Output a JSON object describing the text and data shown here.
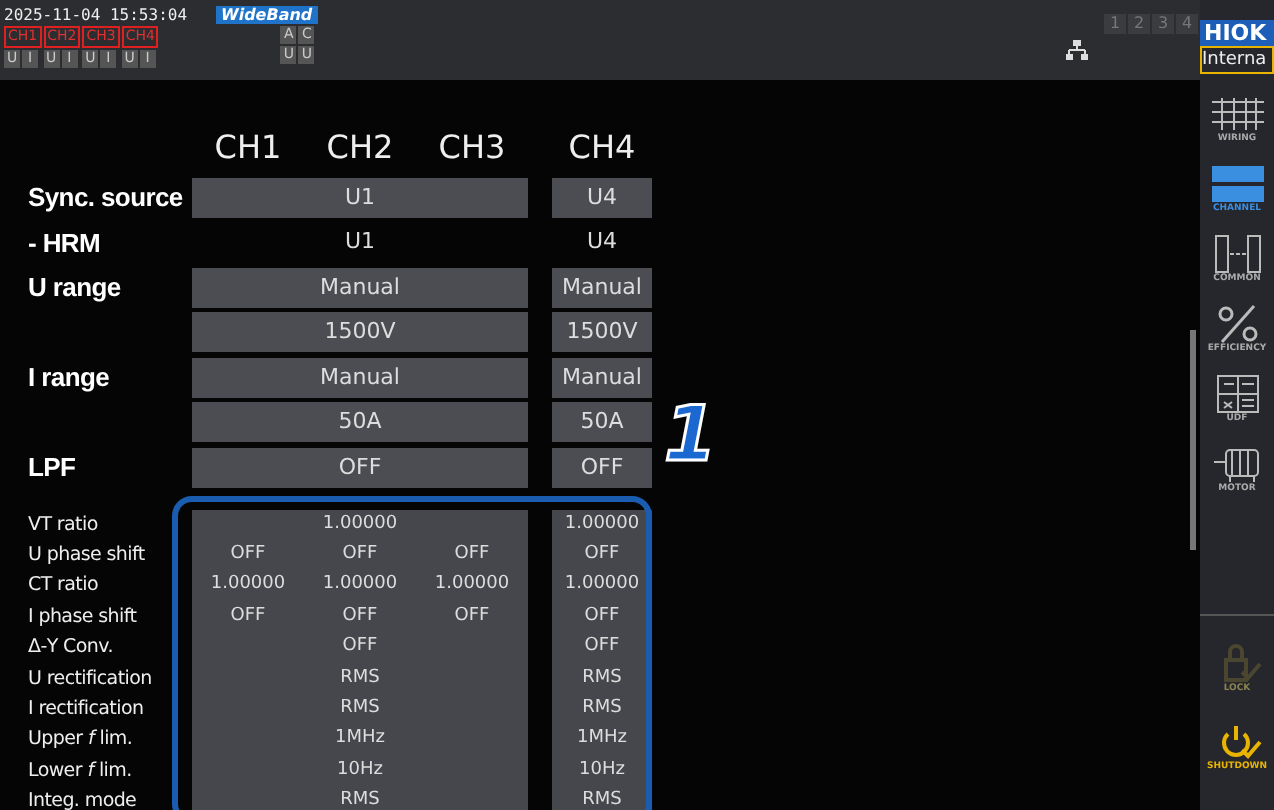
{
  "status_bar": {
    "datetime": "2025-11-04 15:53:04",
    "mode_badge": "WideBand",
    "channels": [
      {
        "label": "CH1",
        "inputs": [
          "U",
          "I"
        ]
      },
      {
        "label": "CH2",
        "inputs": [
          "U",
          "I"
        ]
      },
      {
        "label": "CH3",
        "inputs": [
          "U",
          "I"
        ]
      },
      {
        "label": "CH4",
        "inputs": [
          "U",
          "I"
        ]
      }
    ],
    "aux_top": [
      "A",
      "C"
    ],
    "aux_bottom": [
      "U",
      "U"
    ],
    "slots": [
      "1",
      "2",
      "3",
      "4"
    ],
    "logo": "HIOK",
    "sync_field": "Interna"
  },
  "table": {
    "columns": [
      "CH1",
      "CH2",
      "CH3",
      "CH4"
    ],
    "rows": [
      {
        "label": "Sync. source",
        "kind": "select",
        "cells": [
          "U1"
        ],
        "ch4": "U4"
      },
      {
        "label": "- HRM",
        "kind": "plain",
        "cells": [
          "U1"
        ],
        "ch4": "U4"
      },
      {
        "label": "U range",
        "kind": "select",
        "cells": [
          "Manual"
        ],
        "ch4": "Manual"
      },
      {
        "label": "",
        "kind": "select",
        "cells": [
          "1500V"
        ],
        "ch4": "1500V"
      },
      {
        "label": "I range",
        "kind": "select",
        "cells": [
          "Manual"
        ],
        "ch4": "Manual"
      },
      {
        "label": "",
        "kind": "select",
        "cells": [
          "50A"
        ],
        "ch4": "50A"
      },
      {
        "label": "LPF",
        "kind": "select",
        "cells": [
          "OFF"
        ],
        "ch4": "OFF"
      }
    ],
    "detail_rows": [
      {
        "label": "VT ratio",
        "cells": [
          "1.00000"
        ],
        "ch4": "1.00000"
      },
      {
        "label": "U phase shift",
        "cells": [
          "OFF",
          "OFF",
          "OFF"
        ],
        "ch4": "OFF"
      },
      {
        "label": "CT ratio",
        "cells": [
          "1.00000",
          "1.00000",
          "1.00000"
        ],
        "ch4": "1.00000"
      },
      {
        "label": "I phase shift",
        "cells": [
          "OFF",
          "OFF",
          "OFF"
        ],
        "ch4": "OFF"
      },
      {
        "label": "Δ-Y Conv.",
        "cells": [
          "OFF"
        ],
        "ch4": "OFF"
      },
      {
        "label": "U rectification",
        "cells": [
          "RMS"
        ],
        "ch4": "RMS"
      },
      {
        "label": "I rectification",
        "cells": [
          "RMS"
        ],
        "ch4": "RMS"
      },
      {
        "label": "Upper *f* lim.",
        "cells": [
          "1MHz"
        ],
        "ch4": "1MHz"
      },
      {
        "label": "Lower *f* lim.",
        "cells": [
          "10Hz"
        ],
        "ch4": "10Hz"
      },
      {
        "label": "Integ. mode",
        "cells": [
          "RMS"
        ],
        "ch4": "RMS"
      }
    ]
  },
  "callout": {
    "number": "1"
  },
  "sidebar": {
    "items": [
      {
        "label": "WIRING",
        "selected": false
      },
      {
        "label": "CHANNEL",
        "selected": true
      },
      {
        "label": "COMMON",
        "selected": false
      },
      {
        "label": "EFFICIENCY",
        "selected": false
      },
      {
        "label": "UDF",
        "selected": false
      },
      {
        "label": "MOTOR",
        "selected": false
      }
    ],
    "actions": [
      {
        "label": "LOCK",
        "disabled": true
      },
      {
        "label": "SHUTDOWN",
        "disabled": false
      }
    ]
  }
}
